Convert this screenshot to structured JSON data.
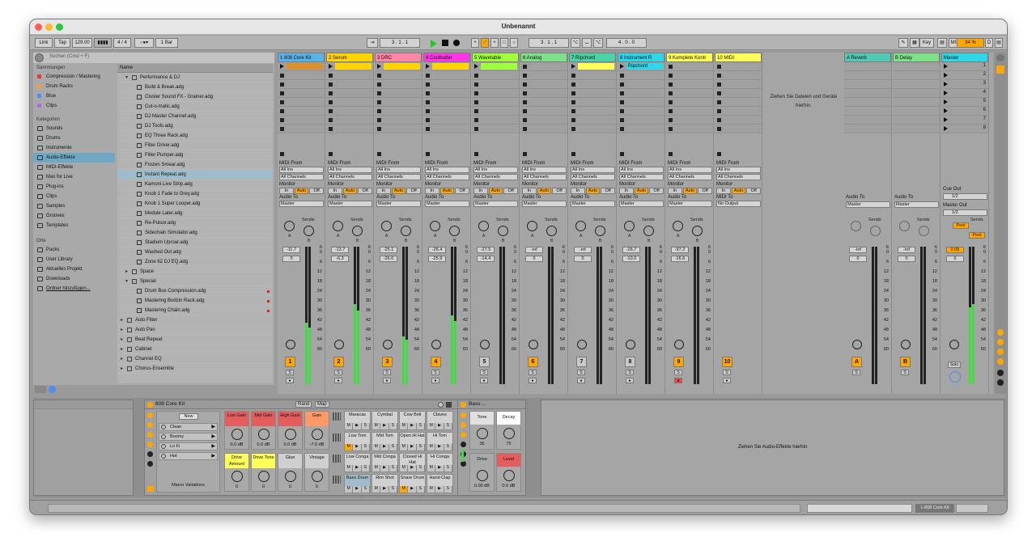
{
  "window": {
    "title": "Unbenannt"
  },
  "transport": {
    "link": "Link",
    "tap": "Tap",
    "tempo": "129.00",
    "sig": "4 / 4",
    "quant": "1 Bar",
    "pos1": "3 .   1 .   1",
    "pos2": "3 .   1 .   1",
    "len": "4 .   0 .   0",
    "key": "Key",
    "midi": "MIDI",
    "zoom": "34 %"
  },
  "browser": {
    "search_placeholder": "Suchen (Cmd + F)",
    "sammlungen_title": "Sammlungen",
    "sammlungen": [
      {
        "label": "Compression / Mastering",
        "color": "#e23b3b"
      },
      {
        "label": "Drum Racks",
        "color": "#ff9b2f"
      },
      {
        "label": "Blue",
        "color": "#4e8df5"
      },
      {
        "label": "Clips",
        "color": "#a96de0"
      }
    ],
    "kategorien_title": "Kategorien",
    "kategorien": [
      "Sounds",
      "Drums",
      "Instrumente",
      "Audio-Effekte",
      "MIDI-Effekte",
      "Max for Live",
      "Plug-ins",
      "Clips",
      "Samples",
      "Grooves",
      "Templates"
    ],
    "orte_title": "Orte",
    "orte": [
      "Packs",
      "User Library",
      "Aktuelles Projekt",
      "Downloads",
      "Ordner hinzufügen..."
    ],
    "name_header": "Name",
    "files": [
      {
        "label": "Performance & DJ",
        "type": "folder-open",
        "indent": 0
      },
      {
        "label": "Build & Break.adg",
        "indent": 1
      },
      {
        "label": "Cluster Sound FX - Grainer.adg",
        "indent": 1
      },
      {
        "label": "Cut-o-matic.adg",
        "indent": 1
      },
      {
        "label": "DJ Master Channel.adg",
        "indent": 1
      },
      {
        "label": "DJ Tools.adg",
        "indent": 1
      },
      {
        "label": "EQ Three Rack.adg",
        "indent": 1
      },
      {
        "label": "Filter Driver.adg",
        "indent": 1
      },
      {
        "label": "Filter Pumper.adg",
        "indent": 1
      },
      {
        "label": "Frozen Smear.adg",
        "indent": 1
      },
      {
        "label": "Instant Repeat.adg",
        "indent": 1,
        "selected": true
      },
      {
        "label": "Kamoni Live Strip.adg",
        "indent": 1
      },
      {
        "label": "Knob 1 Fade to Grey.adg",
        "indent": 1
      },
      {
        "label": "Knob 1 Super Looper.adg",
        "indent": 1
      },
      {
        "label": "Module Later.adg",
        "indent": 1
      },
      {
        "label": "Re-Pulsor.adg",
        "indent": 1
      },
      {
        "label": "Sidechain Simulator.adg",
        "indent": 1
      },
      {
        "label": "Stadium Uproar.adg",
        "indent": 1
      },
      {
        "label": "Washed Out.adg",
        "indent": 1
      },
      {
        "label": "Zone 62 DJ EQ.adg",
        "indent": 1
      },
      {
        "label": "Space",
        "type": "folder",
        "indent": 0
      },
      {
        "label": "Special",
        "type": "folder-open",
        "indent": 0
      },
      {
        "label": "Drum Bus Compression.adg",
        "indent": 1,
        "red": true
      },
      {
        "label": "Mastering Bodzin Rack.adg",
        "indent": 1,
        "red": true
      },
      {
        "label": "Mastering Chain.adg",
        "indent": 1,
        "red": true
      },
      {
        "label": "Auto Filter",
        "type": "folder",
        "indent": -1
      },
      {
        "label": "Auto Pan",
        "type": "folder",
        "indent": -1
      },
      {
        "label": "Beat Repeat",
        "type": "folder",
        "indent": -1
      },
      {
        "label": "Cabinet",
        "type": "folder",
        "indent": -1
      },
      {
        "label": "Channel EQ",
        "type": "folder",
        "indent": -1
      },
      {
        "label": "Chorus-Ensemble",
        "type": "folder",
        "indent": -1
      }
    ]
  },
  "tracks": [
    {
      "name": "1 808 Core Kit",
      "color": "#5bb2e5",
      "clip": "",
      "clipcolor": "#d9902f",
      "num": "1",
      "vol": "-11.7",
      "pan": "0",
      "level": 0.45,
      "midi": true,
      "out": "Master"
    },
    {
      "name": "2 Serum",
      "color": "#ffd400",
      "clip": "",
      "clipcolor": "#ffd400",
      "num": "2",
      "vol": "-13.7",
      "pan": "-6.3",
      "level": 0.58,
      "midi": true,
      "out": "Master"
    },
    {
      "name": "3 DRC",
      "color": "#ff87a6",
      "clip": "",
      "clipcolor": "#ffd400",
      "num": "3",
      "vol": "-25.1",
      "pan": "-26.0",
      "level": 0.35,
      "midi": true,
      "out": "Master"
    },
    {
      "name": "4 Coolbutter",
      "color": "#ff36e4",
      "clip": "",
      "clipcolor": "#ffd400",
      "num": "4",
      "vol": "-26.4",
      "pan": "-25.9",
      "level": 0.5,
      "midi": true,
      "out": "Master"
    },
    {
      "name": "5 Wavetable",
      "color": "#a0ff3b",
      "clip": "",
      "clipcolor": "#a0ff3b",
      "num": "5",
      "vol": "-27.5",
      "pan": "-14.4",
      "level": 0.0,
      "midi": true,
      "out": "Master"
    },
    {
      "name": "6 Analog",
      "color": "#7fe08a",
      "clip": "",
      "clipcolor": "",
      "num": "6",
      "vol": "-inf",
      "pan": "0",
      "level": 0.0,
      "midi": true,
      "out": "Master"
    },
    {
      "name": "7 Ripchord",
      "color": "#4cd3a3",
      "clip": "",
      "clipcolor": "#ffff5a",
      "num": "7",
      "vol": "-inf",
      "pan": "0",
      "level": 0.0,
      "midi": true,
      "out": "Master"
    },
    {
      "name": "8 Instrument R",
      "color": "#2fd6e8",
      "clip": "Ripchord",
      "clipcolor": "#2fd6e8",
      "num": "8",
      "vol": "-26.7",
      "pan": "-10.0",
      "level": 0.0,
      "midi": true,
      "out": "Master"
    },
    {
      "name": "9 Komplete Kontr",
      "color": "#ffff5a",
      "clip": "",
      "clipcolor": "",
      "num": "9",
      "vol": "-97.2",
      "pan": "-16.6",
      "level": 0.0,
      "midi": true,
      "out": "Master"
    },
    {
      "name": "10 MIDI",
      "color": "#ffff5a",
      "clip": "",
      "clipcolor": "",
      "num": "10",
      "vol": "",
      "pan": "",
      "level": 0.0,
      "midi": true,
      "out": "No Output"
    }
  ],
  "io": {
    "midi_from": "MIDI From",
    "all_ins": "All Ins",
    "all_channels": "All Channels",
    "monitor": "Monitor",
    "in": "In",
    "auto": "Auto",
    "off": "Off",
    "audio_to": "Audio To",
    "midi_to": "MIDI To",
    "sends": "Sends",
    "send_a": "A",
    "send_b": "B"
  },
  "scale": [
    "6",
    "0",
    "6",
    "12",
    "18",
    "24",
    "30",
    "36",
    "42",
    "48",
    "54",
    "60"
  ],
  "dropzone": {
    "text": "Ziehen Sie Dateien und Geräte hierhin."
  },
  "returns": [
    {
      "name": "A Reverb",
      "color": "#52c8b2",
      "vol": "-Inf",
      "pan": "0",
      "num": "A",
      "out": "Master"
    },
    {
      "name": "B Delay",
      "color": "#7fe08a",
      "vol": "-Inf",
      "pan": "0",
      "num": "B",
      "out": "Master"
    },
    {
      "name": "Master",
      "color": "#2fd6e8",
      "vol": "0.09",
      "pan": "0",
      "num": "",
      "out": ""
    }
  ],
  "master": {
    "cue_out": "Cue Out",
    "cue_val": "1/2",
    "master_out": "Master Out",
    "master_val": "1/2",
    "post": "Post",
    "solo": "Solo",
    "scenes": [
      "1",
      "2",
      "3",
      "4",
      "5",
      "6",
      "7",
      "8"
    ]
  },
  "device": {
    "rack_title": "808 Core Kit",
    "rand": "Rand",
    "map": "Map",
    "new": "New",
    "variations": [
      "Clean",
      "Boomy",
      "Lo Fi",
      "Hot"
    ],
    "macro_variations": "Macro Variations",
    "macros": [
      {
        "label": "Low Gain",
        "value": "0.0 dB",
        "color": "#e55c5c"
      },
      {
        "label": "Mid Gain",
        "value": "0.0 dB",
        "color": "#e55c5c"
      },
      {
        "label": "High Gain",
        "value": "0.0 dB",
        "color": "#e55c5c"
      },
      {
        "label": "Gain",
        "value": "-7.0 dB",
        "color": "#ff9966"
      },
      {
        "label": "Drive Amount",
        "value": "0",
        "color": "#ffff5a"
      },
      {
        "label": "Drive Tone",
        "value": "0",
        "color": "#ffff5a"
      },
      {
        "label": "Glue",
        "value": "0",
        "color": "#cfcfcf"
      },
      {
        "label": "Vintage",
        "value": "0",
        "color": "#cfcfcf"
      }
    ],
    "pads": [
      "Maracas",
      "Cymbal",
      "Cow Bell",
      "Claves",
      "Low Tom",
      "Mid Tom",
      "Open Hi Hat",
      "Hi Tom",
      "Low Conga",
      "Mid Conga",
      "Closed Hi Hat",
      "Hi Conga",
      "Bass Drum",
      "Rim Shot",
      "Snare Drum",
      "Hand Clap"
    ],
    "pad_btns": {
      "m": "M",
      "play": "▶",
      "s": "S"
    },
    "bass_title": "Bass ...",
    "bass": [
      {
        "label": "Tone",
        "value": "36"
      },
      {
        "label": "Decay",
        "value": "75"
      },
      {
        "label": "Drive",
        "value": "0.00 dB"
      },
      {
        "label": "Level",
        "value": "0.0 dB"
      }
    ],
    "fx_drop": "Ziehen Sie Audio-Effekte hierhin"
  },
  "status": {
    "track": "1-808 Core Kit"
  }
}
